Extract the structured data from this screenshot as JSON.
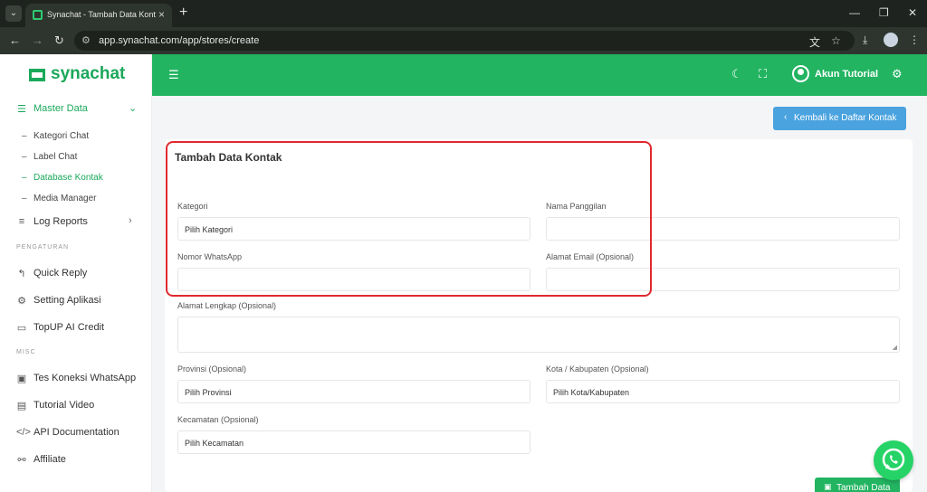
{
  "browser": {
    "tab_title": "Synachat - Tambah Data Kontak",
    "url": "app.synachat.com/app/stores/create"
  },
  "sidebar": {
    "logo": "synachat",
    "master_data": "Master Data",
    "sub_items": [
      "Kategori Chat",
      "Label Chat",
      "Database Kontak",
      "Media Manager"
    ],
    "log_reports": "Log Reports",
    "section_pengaturan": "PENGATURAN",
    "pengaturan_items": [
      "Quick Reply",
      "Setting Aplikasi",
      "TopUP AI Credit"
    ],
    "section_misc": "MISC",
    "misc_items": [
      "Tes Koneksi WhatsApp",
      "Tutorial Video",
      "API Documentation",
      "Affiliate"
    ]
  },
  "header": {
    "user_name": "Akun Tutorial"
  },
  "main": {
    "back_button": "Kembali ke Daftar Kontak",
    "form_title": "Tambah Data Kontak",
    "labels": {
      "kategori": "Kategori",
      "nama_panggilan": "Nama Panggilan",
      "nomor_whatsapp": "Nomor WhatsApp",
      "alamat_email": "Alamat Email (Opsional)",
      "alamat_lengkap": "Alamat Lengkap (Opsional)",
      "provinsi": "Provinsi (Opsional)",
      "kota": "Kota / Kabupaten (Opsional)",
      "kecamatan": "Kecamatan (Opsional)"
    },
    "values": {
      "kategori": "Pilih Kategori",
      "provinsi": "Pilih Provinsi",
      "kota": "Pilih Kota/Kabupaten",
      "kecamatan": "Pilih Kecamatan"
    },
    "submit_button": "Tambah Data"
  },
  "colors": {
    "brand_green": "#22b461",
    "back_button_blue": "#4aa3df",
    "highlight_red": "#e0292f"
  }
}
